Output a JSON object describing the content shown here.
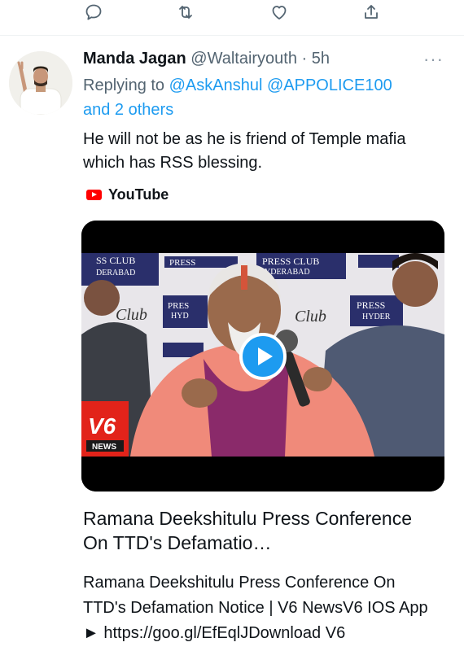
{
  "actions": {
    "reply_icon": "reply-icon",
    "retweet_icon": "retweet-icon",
    "like_icon": "like-icon",
    "share_icon": "share-icon"
  },
  "tweet": {
    "author_name": "Manda Jagan",
    "author_handle": "@Waltairyouth",
    "separator": "·",
    "time": "5h",
    "more": "···",
    "replying_prefix": "Replying to",
    "replying_user1": "@AskAnshul",
    "replying_user2": "@APPOLICE100",
    "replying_others": "and 2 others",
    "text": "He will not be as he is friend of Temple mafia which has RSS blessing."
  },
  "card": {
    "source": "YouTube",
    "thumb_banner_1": "SS CLUB",
    "thumb_banner_1b": "DERABAD",
    "thumb_banner_2": "PRESS CLUB",
    "thumb_banner_2b": "YDERABAD",
    "thumb_banner_3": "PRESS",
    "thumb_banner_4": "PRESS",
    "thumb_banner_4b": "HYDER",
    "thumb_banner_5": "PRES",
    "thumb_banner_5b": "HYD",
    "thumb_club": "Club",
    "channel_logo": "V6",
    "channel_sub": "NEWS",
    "title": "Ramana Deekshitulu Press Conference On TTD's Defamatio…",
    "description": "Ramana Deekshitulu Press Conference On TTD's Defamation Notice | V6 NewsV6 IOS App ► https://goo.gl/EfEqlJDownload V6"
  },
  "colors": {
    "link": "#1d9bf0",
    "muted": "#536471",
    "text": "#0f1419",
    "youtube_red": "#ff0000"
  }
}
